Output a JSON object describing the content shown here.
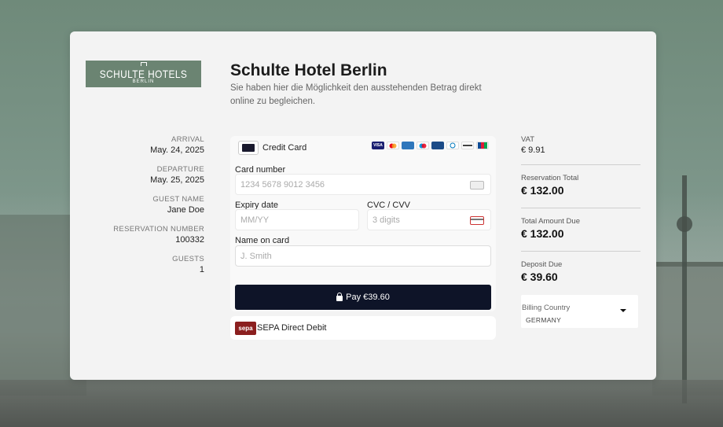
{
  "hotel": {
    "logo_main": "SCHULTE HOTELS",
    "logo_sub": "BERLIN",
    "title": "Schulte Hotel Berlin",
    "description": "Sie haben hier die Möglichkeit den ausstehenden Betrag direkt online zu begleichen."
  },
  "booking": {
    "arrival_label": "ARRIVAL",
    "arrival": "May. 24, 2025",
    "departure_label": "DEPARTURE",
    "departure": "May. 25, 2025",
    "guest_label": "GUEST NAME",
    "guest": "Jane Doe",
    "reservation_label": "RESERVATION NUMBER",
    "reservation": "100332",
    "guests_label": "GUESTS",
    "guests": "1"
  },
  "payment": {
    "method_label": "Credit Card",
    "card_brands": [
      "VISA",
      "MC",
      "AMEX",
      "Maestro",
      "UnionPay",
      "Diners",
      "Discover",
      "JCB"
    ],
    "card_number_label": "Card number",
    "card_number_placeholder": "1234 5678 9012 3456",
    "expiry_label": "Expiry date",
    "expiry_placeholder": "MM/YY",
    "cvc_label": "CVC / CVV",
    "cvc_placeholder": "3 digits",
    "name_label": "Name on card",
    "name_placeholder": "J. Smith",
    "pay_button": "Pay €39.60",
    "sepa_logo": "sepa",
    "sepa_label": "SEPA Direct Debit"
  },
  "summary": {
    "vat_label": "VAT",
    "vat": "€ 9.91",
    "reservation_total_label": "Reservation Total",
    "reservation_total": "€ 132.00",
    "total_due_label": "Total Amount Due",
    "total_due": "€ 132.00",
    "deposit_label": "Deposit Due",
    "deposit": "€ 39.60",
    "billing_country_label": "Billing Country",
    "billing_country": "GERMANY"
  },
  "colors": {
    "logo_bg": "#6b8472",
    "pay_button_bg": "#0e1428",
    "sepa_bg": "#8b1f1f"
  }
}
